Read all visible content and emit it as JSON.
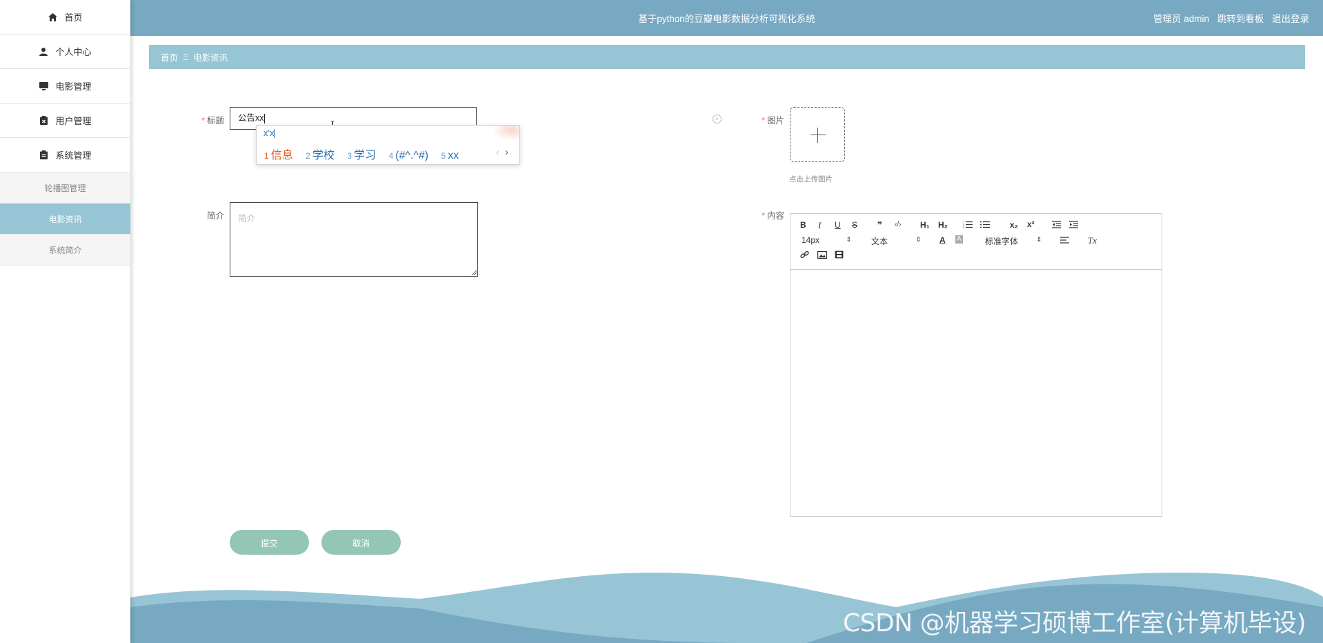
{
  "app": {
    "title": "基于python的豆瓣电影数据分析可视化系统",
    "user": "管理员 admin",
    "jump_board": "跳转到看板",
    "logout": "退出登录"
  },
  "sidebar": {
    "items": [
      {
        "label": "首页",
        "icon": "home-icon"
      },
      {
        "label": "个人中心",
        "icon": "user-icon"
      },
      {
        "label": "电影管理",
        "icon": "monitor-icon"
      },
      {
        "label": "用户管理",
        "icon": "clipboard-x-icon"
      },
      {
        "label": "系统管理",
        "icon": "clipboard-icon"
      }
    ],
    "sub_items": [
      {
        "label": "轮播图管理",
        "active": false
      },
      {
        "label": "电影资讯",
        "active": true
      },
      {
        "label": "系统简介",
        "active": false
      }
    ]
  },
  "breadcrumb": {
    "home": "首页",
    "separator": "Ξ",
    "current": "电影资讯"
  },
  "form": {
    "title_label": "标题",
    "title_value": "公告xx",
    "intro_label": "简介",
    "intro_placeholder": "简介",
    "image_label": "图片",
    "upload_tip": "点击上传图片",
    "content_label": "内容",
    "submit": "提交",
    "cancel": "取消"
  },
  "ime": {
    "typed": "x'x",
    "candidates": [
      {
        "num": "1",
        "text": "信息"
      },
      {
        "num": "2",
        "text": "学校"
      },
      {
        "num": "3",
        "text": "学习"
      },
      {
        "num": "4",
        "text": "(#^.^#)"
      },
      {
        "num": "5",
        "text": "xx"
      }
    ],
    "prev": "‹",
    "next": "›"
  },
  "editor_toolbar": {
    "bold": "B",
    "italic": "I",
    "underline": "U",
    "strike": "S",
    "blockquote": "❞",
    "code": "‹/›",
    "h1": "H₁",
    "h2": "H₂",
    "subscript": "x₂",
    "superscript": "x²",
    "font_size": "14px",
    "header_select": "文本",
    "font_family": "标准字体",
    "font_color": "A",
    "background_color": "A",
    "clear_format": "Tx"
  },
  "watermark": "CSDN @机器学习硕博工作室(计算机毕设)",
  "colors": {
    "topbar": "#78a9c2",
    "breadcrumb": "#96c6d6",
    "active_menu": "#96c6d6",
    "button": "#93c6b4",
    "required": "#f56c6c"
  }
}
